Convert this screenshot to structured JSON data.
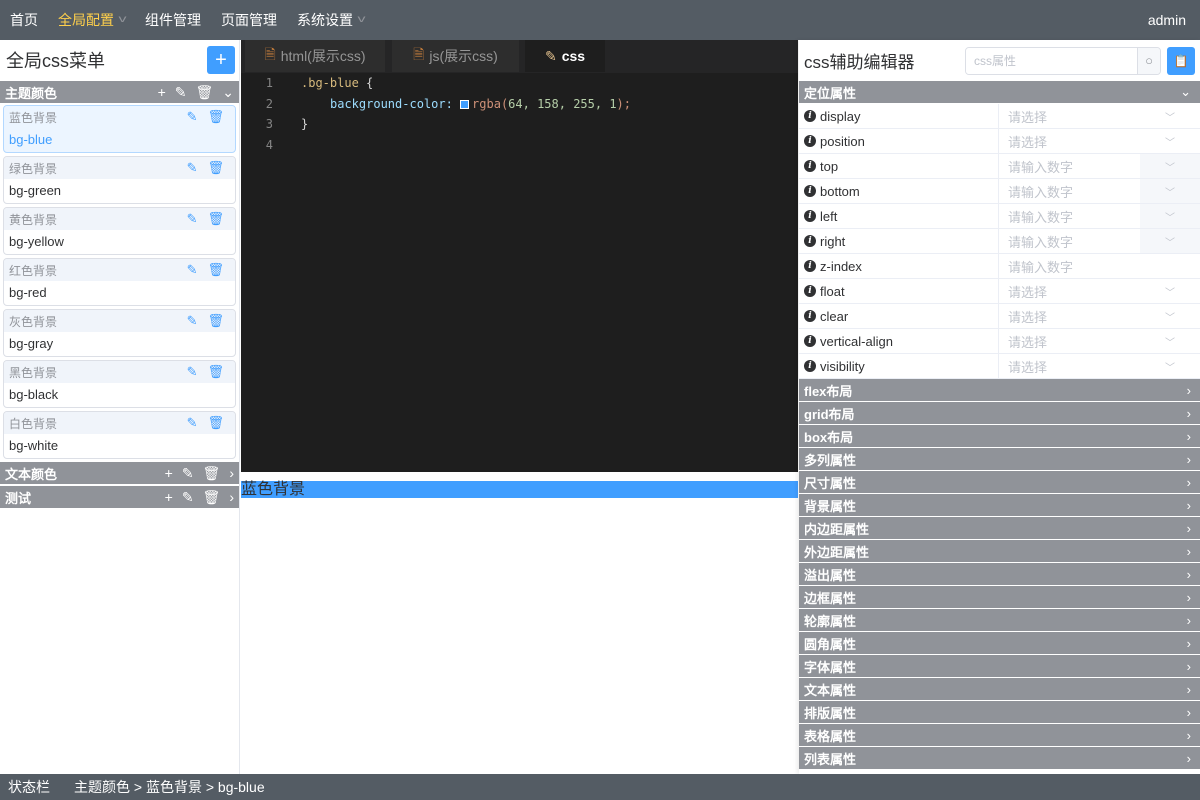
{
  "nav": {
    "items": [
      {
        "label": "首页"
      },
      {
        "label": "全局配置",
        "active": true,
        "dropdown": true
      },
      {
        "label": "组件管理"
      },
      {
        "label": "页面管理"
      },
      {
        "label": "系统设置",
        "dropdown": true
      }
    ],
    "user": "admin"
  },
  "left": {
    "title": "全局css菜单",
    "add_label": "+",
    "groups": [
      {
        "name": "主题颜色",
        "expanded": true,
        "items": [
          {
            "label": "蓝色背景",
            "value": "bg-blue",
            "selected": true
          },
          {
            "label": "绿色背景",
            "value": "bg-green"
          },
          {
            "label": "黄色背景",
            "value": "bg-yellow"
          },
          {
            "label": "红色背景",
            "value": "bg-red"
          },
          {
            "label": "灰色背景",
            "value": "bg-gray"
          },
          {
            "label": "黑色背景",
            "value": "bg-black"
          },
          {
            "label": "白色背景",
            "value": "bg-white"
          }
        ]
      },
      {
        "name": "文本颜色",
        "expanded": false
      },
      {
        "name": "测试",
        "expanded": false
      }
    ]
  },
  "editor": {
    "tabs": [
      {
        "label": "html(展示css)",
        "icon": "file-icon"
      },
      {
        "label": "js(展示css)",
        "icon": "file-icon"
      },
      {
        "label": "css",
        "icon": "edit-icon",
        "active": true
      }
    ],
    "lines": [
      "1",
      "2",
      "3",
      "4"
    ],
    "code": {
      "selector": ".bg-blue",
      "open": " {",
      "prop": "background-color: ",
      "fn": "rgba(",
      "args": "64, 158, 255, 1",
      "close_fn": ");",
      "close": "}"
    }
  },
  "preview": {
    "text": "蓝色背景",
    "color": "#409eff"
  },
  "right": {
    "title": "css辅助编辑器",
    "search_placeholder": "css属性",
    "open_section": "定位属性",
    "props": [
      {
        "name": "display",
        "placeholder": "请选择",
        "type": "select"
      },
      {
        "name": "position",
        "placeholder": "请选择",
        "type": "select"
      },
      {
        "name": "top",
        "placeholder": "请输入数字",
        "type": "number"
      },
      {
        "name": "bottom",
        "placeholder": "请输入数字",
        "type": "number"
      },
      {
        "name": "left",
        "placeholder": "请输入数字",
        "type": "number"
      },
      {
        "name": "right",
        "placeholder": "请输入数字",
        "type": "number"
      },
      {
        "name": "z-index",
        "placeholder": "请输入数字",
        "type": "input"
      },
      {
        "name": "float",
        "placeholder": "请选择",
        "type": "select"
      },
      {
        "name": "clear",
        "placeholder": "请选择",
        "type": "select"
      },
      {
        "name": "vertical-align",
        "placeholder": "请选择",
        "type": "select"
      },
      {
        "name": "visibility",
        "placeholder": "请选择",
        "type": "select"
      }
    ],
    "sections": [
      "flex布局",
      "grid布局",
      "box布局",
      "多列属性",
      "尺寸属性",
      "背景属性",
      "内边距属性",
      "外边距属性",
      "溢出属性",
      "边框属性",
      "轮廓属性",
      "圆角属性",
      "字体属性",
      "文本属性",
      "排版属性",
      "表格属性",
      "列表属性"
    ]
  },
  "status": {
    "label": "状态栏",
    "breadcrumb": "主题颜色 > 蓝色背景 > bg-blue"
  },
  "colors": {
    "nav": "#545c64",
    "accent": "#409eff",
    "active_nav": "#ffd04b",
    "section": "#909399",
    "editor_bg": "#1e1e1e"
  }
}
